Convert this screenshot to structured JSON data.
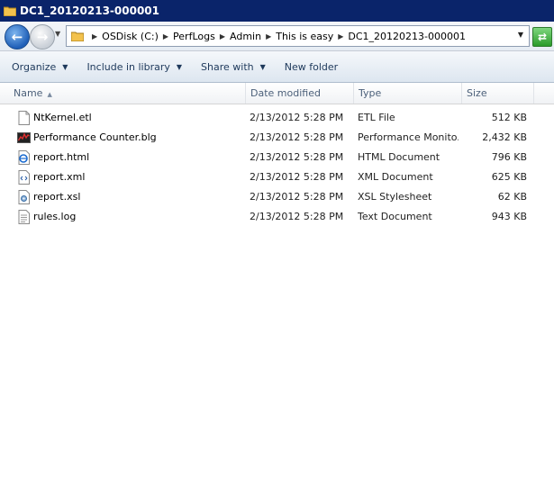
{
  "window": {
    "title": "DC1_20120213-000001"
  },
  "address": {
    "crumbs": [
      "OSDisk (C:)",
      "PerfLogs",
      "Admin",
      "This is easy",
      "DC1_20120213-000001"
    ]
  },
  "toolbar": {
    "organize": "Organize",
    "include": "Include in library",
    "share": "Share with",
    "new_folder": "New folder"
  },
  "columns": {
    "name": "Name",
    "date": "Date modified",
    "type": "Type",
    "size": "Size"
  },
  "files": [
    {
      "name": "NtKernel.etl",
      "date": "2/13/2012 5:28 PM",
      "type": "ETL File",
      "size": "512 KB",
      "icon": "blank-file-icon"
    },
    {
      "name": "Performance Counter.blg",
      "date": "2/13/2012 5:28 PM",
      "type": "Performance Monito...",
      "size": "2,432 KB",
      "icon": "perfmon-file-icon"
    },
    {
      "name": "report.html",
      "date": "2/13/2012 5:28 PM",
      "type": "HTML Document",
      "size": "796 KB",
      "icon": "html-file-icon"
    },
    {
      "name": "report.xml",
      "date": "2/13/2012 5:28 PM",
      "type": "XML Document",
      "size": "625 KB",
      "icon": "xml-file-icon"
    },
    {
      "name": "report.xsl",
      "date": "2/13/2012 5:28 PM",
      "type": "XSL Stylesheet",
      "size": "62 KB",
      "icon": "xsl-file-icon"
    },
    {
      "name": "rules.log",
      "date": "2/13/2012 5:28 PM",
      "type": "Text Document",
      "size": "943 KB",
      "icon": "text-file-icon"
    }
  ],
  "colors": {
    "titlebar": "#0a246a",
    "header_text": "#4c607a",
    "command_text": "#1e395b"
  }
}
